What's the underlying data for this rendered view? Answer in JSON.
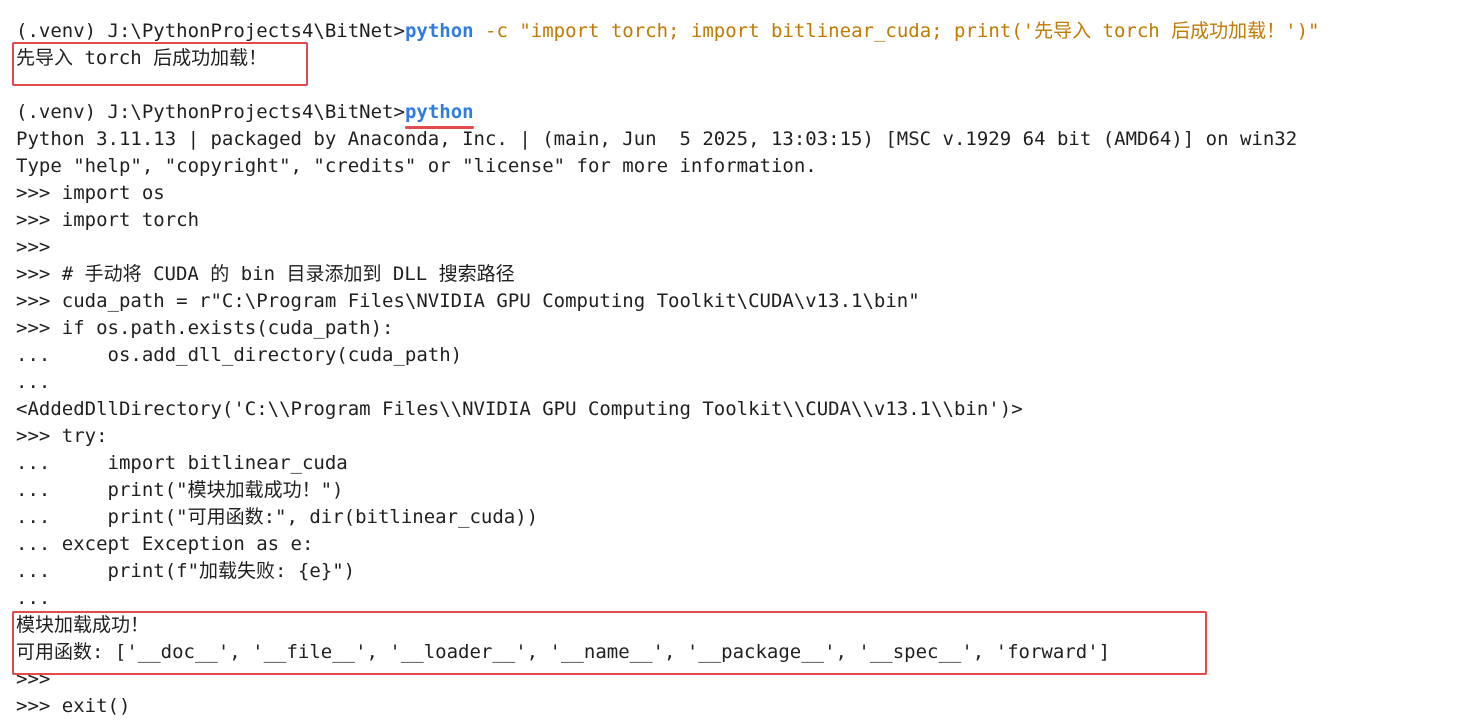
{
  "terminal": {
    "lines": {
      "l1_prompt": "(.venv) J:\\PythonProjects4\\BitNet>",
      "l1_cmd": "python",
      "l1_args": " -c \"import torch; import bitlinear_cuda; print('先导入 torch 后成功加载！')\"",
      "l2": "先导入 torch 后成功加载！",
      "l3": "",
      "l4_prompt": "(.venv) J:\\PythonProjects4\\BitNet>",
      "l4_cmd": "python",
      "l5": "Python 3.11.13 | packaged by Anaconda, Inc. | (main, Jun  5 2025, 13:03:15) [MSC v.1929 64 bit (AMD64)] on win32",
      "l6": "Type \"help\", \"copyright\", \"credits\" or \"license\" for more information.",
      "l7": ">>> import os",
      "l8": ">>> import torch",
      "l9": ">>>",
      "l10": ">>> # 手动将 CUDA 的 bin 目录添加到 DLL 搜索路径",
      "l11": ">>> cuda_path = r\"C:\\Program Files\\NVIDIA GPU Computing Toolkit\\CUDA\\v13.1\\bin\"",
      "l12": ">>> if os.path.exists(cuda_path):",
      "l13": "...     os.add_dll_directory(cuda_path)",
      "l14": "...",
      "l15": "<AddedDllDirectory('C:\\\\Program Files\\\\NVIDIA GPU Computing Toolkit\\\\CUDA\\\\v13.1\\\\bin')>",
      "l16": ">>> try:",
      "l17": "...     import bitlinear_cuda",
      "l18": "...     print(\"模块加载成功！\")",
      "l19": "...     print(\"可用函数:\", dir(bitlinear_cuda))",
      "l20": "... except Exception as e:",
      "l21": "...     print(f\"加载失败: {e}\")",
      "l22": "...",
      "l23": "模块加载成功！",
      "l24": "可用函数: ['__doc__', '__file__', '__loader__', '__name__', '__package__', '__spec__', 'forward']",
      "l25": ">>>",
      "l26": ">>> exit()"
    }
  },
  "colors": {
    "command": "#2f7de1",
    "string": "#c07a00",
    "highlight": "#e14b4b"
  }
}
